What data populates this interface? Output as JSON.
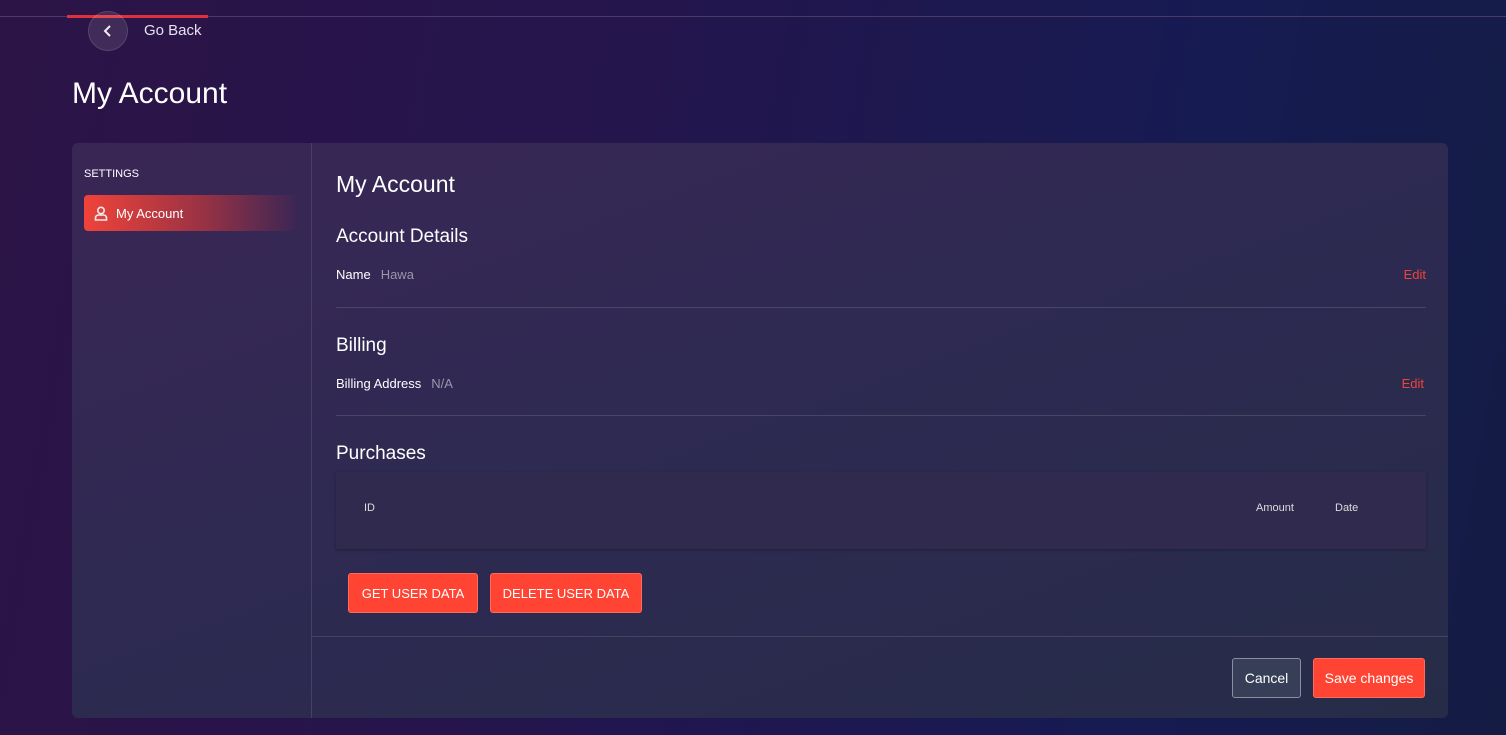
{
  "nav": {
    "back_label": "Go Back"
  },
  "page": {
    "title": "My Account"
  },
  "sidebar": {
    "heading": "SETTINGS",
    "items": [
      {
        "label": "My Account",
        "active": true
      }
    ]
  },
  "main": {
    "title": "My Account",
    "account_details": {
      "heading": "Account Details",
      "name_label": "Name",
      "name_value": "Hawa",
      "edit_label": "Edit"
    },
    "billing": {
      "heading": "Billing",
      "address_label": "Billing Address",
      "address_value": "N/A",
      "edit_label": "Edit"
    },
    "purchases": {
      "heading": "Purchases",
      "columns": [
        "ID",
        "Amount",
        "Date"
      ],
      "rows": []
    },
    "get_data_label": "GET USER DATA",
    "delete_data_label": "DELETE USER DATA"
  },
  "footer": {
    "cancel_label": "Cancel",
    "save_label": "Save changes"
  },
  "colors": {
    "accent": "#ff4433"
  }
}
